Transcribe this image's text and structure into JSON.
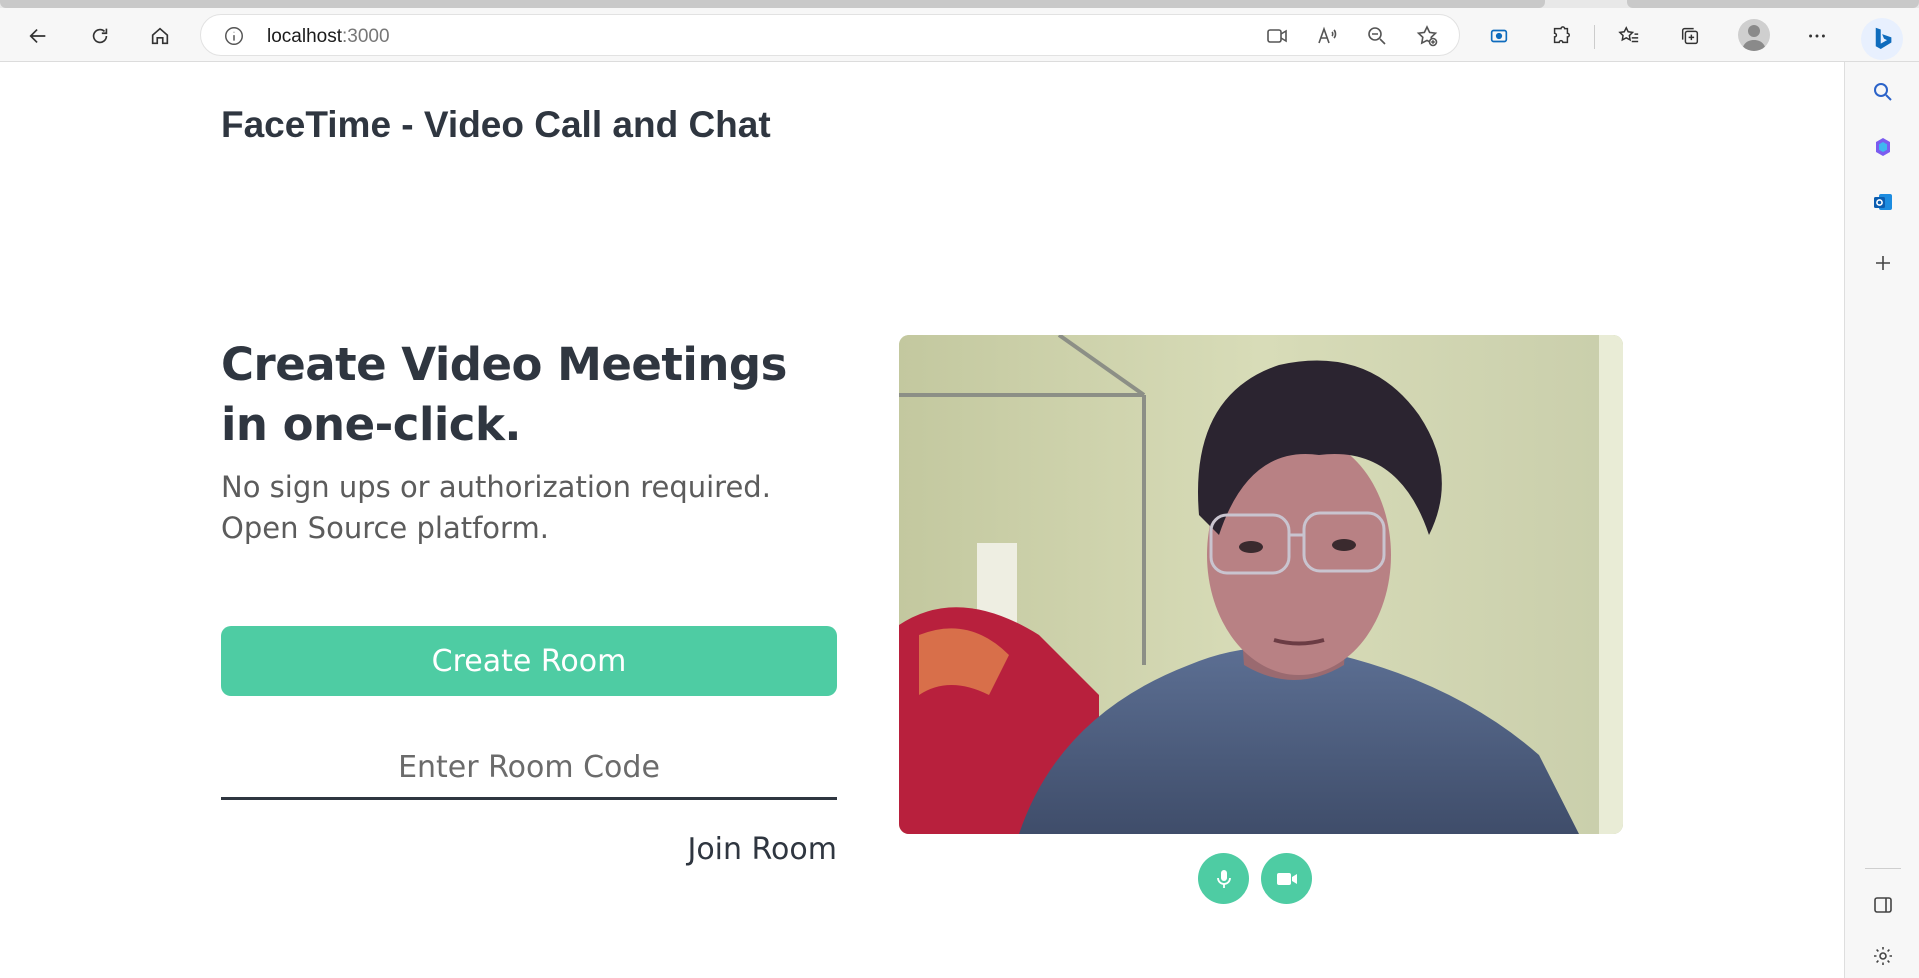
{
  "browser": {
    "url_host": "localhost",
    "url_port": ":3000",
    "accent_color": "#0f6cbd"
  },
  "page": {
    "site_title": "FaceTime - Video Call and Chat",
    "hero_title": "Create Video Meetings in one-click.",
    "hero_subtitle_line1": "No sign ups or authorization required.",
    "hero_subtitle_line2": "Open Source platform.",
    "create_button": "Create Room",
    "room_code_placeholder": "Enter Room Code",
    "join_button": "Join Room",
    "brand_color": "#4ecca3"
  },
  "video_controls": {
    "mic_icon": "microphone-icon",
    "camera_icon": "video-camera-icon"
  },
  "sidebar_icons": [
    "search-icon",
    "copilot-icon",
    "outlook-icon",
    "add-icon",
    "split-screen-icon",
    "settings-icon"
  ]
}
